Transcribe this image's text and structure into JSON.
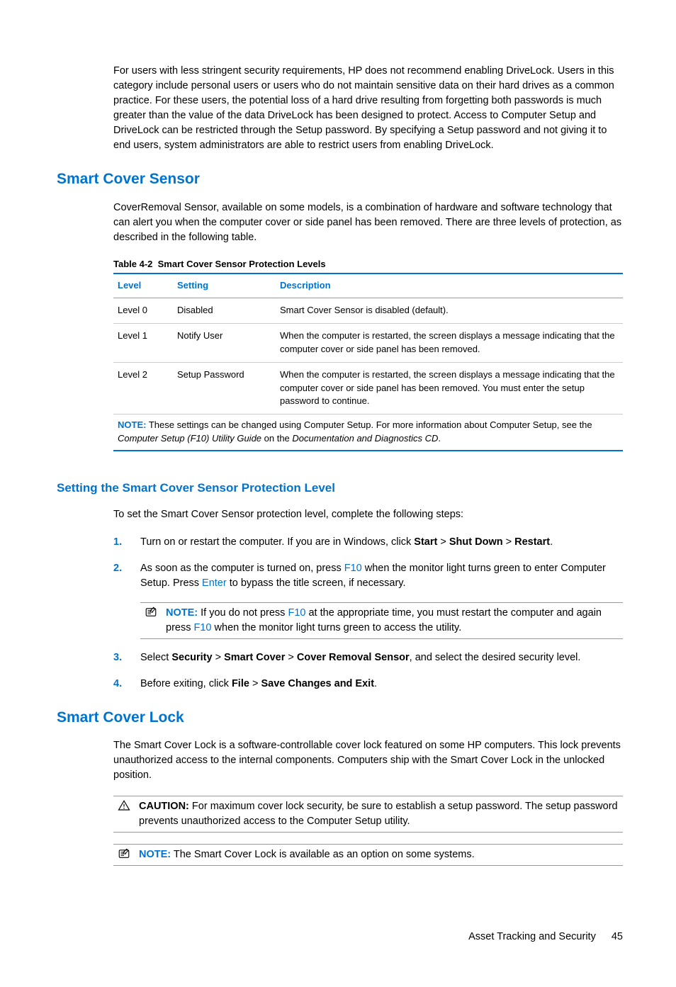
{
  "intro_para": "For users with less stringent security requirements, HP does not recommend enabling DriveLock. Users in this category include personal users or users who do not maintain sensitive data on their hard drives as a common practice. For these users, the potential loss of a hard drive resulting from forgetting both passwords is much greater than the value of the data DriveLock has been designed to protect. Access to Computer Setup and DriveLock can be restricted through the Setup password. By specifying a Setup password and not giving it to end users, system administrators are able to restrict users from enabling DriveLock.",
  "section1": {
    "heading": "Smart Cover Sensor",
    "para": "CoverRemoval Sensor, available on some models, is a combination of hardware and software technology that can alert you when the computer cover or side panel has been removed. There are three levels of protection, as described in the following table.",
    "table_label": "Table 4-2",
    "table_title": "Smart Cover Sensor Protection Levels",
    "headers": {
      "level": "Level",
      "setting": "Setting",
      "description": "Description"
    },
    "rows": [
      {
        "level": "Level 0",
        "setting": "Disabled",
        "description": "Smart Cover Sensor is disabled (default)."
      },
      {
        "level": "Level 1",
        "setting": "Notify User",
        "description": "When the computer is restarted, the screen displays a message indicating that the computer cover or side panel has been removed."
      },
      {
        "level": "Level 2",
        "setting": "Setup Password",
        "description": "When the computer is restarted, the screen displays a message indicating that the computer cover or side panel has been removed. You must enter the setup password to continue."
      }
    ],
    "note_label": "NOTE:",
    "note_text_1": "These settings can be changed using Computer Setup. For more information about Computer Setup, see the ",
    "note_italic_1": "Computer Setup (F10) Utility Guide",
    "note_text_2": " on the ",
    "note_italic_2": "Documentation and Diagnostics CD",
    "note_text_3": "."
  },
  "subsection": {
    "heading": "Setting the Smart Cover Sensor Protection Level",
    "intro": "To set the Smart Cover Sensor protection level, complete the following steps:",
    "step1_a": "Turn on or restart the computer. If you are in Windows, click ",
    "step1_b": "Start",
    "step1_c": " > ",
    "step1_d": "Shut Down",
    "step1_e": " > ",
    "step1_f": "Restart",
    "step1_g": ".",
    "step2_a": "As soon as the computer is turned on, press ",
    "step2_b": "F10",
    "step2_c": " when the monitor light turns green to enter Computer Setup. Press ",
    "step2_d": "Enter",
    "step2_e": " to bypass the title screen, if necessary.",
    "note_label": "NOTE:",
    "note_a": "If you do not press ",
    "note_b": "F10",
    "note_c": " at the appropriate time, you must restart the computer and again press ",
    "note_d": "F10",
    "note_e": " when the monitor light turns green to access the utility.",
    "step3_a": "Select ",
    "step3_b": "Security",
    "step3_c": " > ",
    "step3_d": "Smart Cover",
    "step3_e": " > ",
    "step3_f": "Cover Removal Sensor",
    "step3_g": ", and select the desired security level.",
    "step4_a": "Before exiting, click ",
    "step4_b": "File",
    "step4_c": " > ",
    "step4_d": "Save Changes and Exit",
    "step4_e": "."
  },
  "section2": {
    "heading": "Smart Cover Lock",
    "para": "The Smart Cover Lock is a software-controllable cover lock featured on some HP computers. This lock prevents unauthorized access to the internal components. Computers ship with the Smart Cover Lock in the unlocked position.",
    "caution_label": "CAUTION:",
    "caution_text": "For maximum cover lock security, be sure to establish a setup password. The setup password prevents unauthorized access to the Computer Setup utility.",
    "note_label": "NOTE:",
    "note_text": "The Smart Cover Lock is available as an option on some systems."
  },
  "footer": {
    "text": "Asset Tracking and Security",
    "page": "45"
  }
}
